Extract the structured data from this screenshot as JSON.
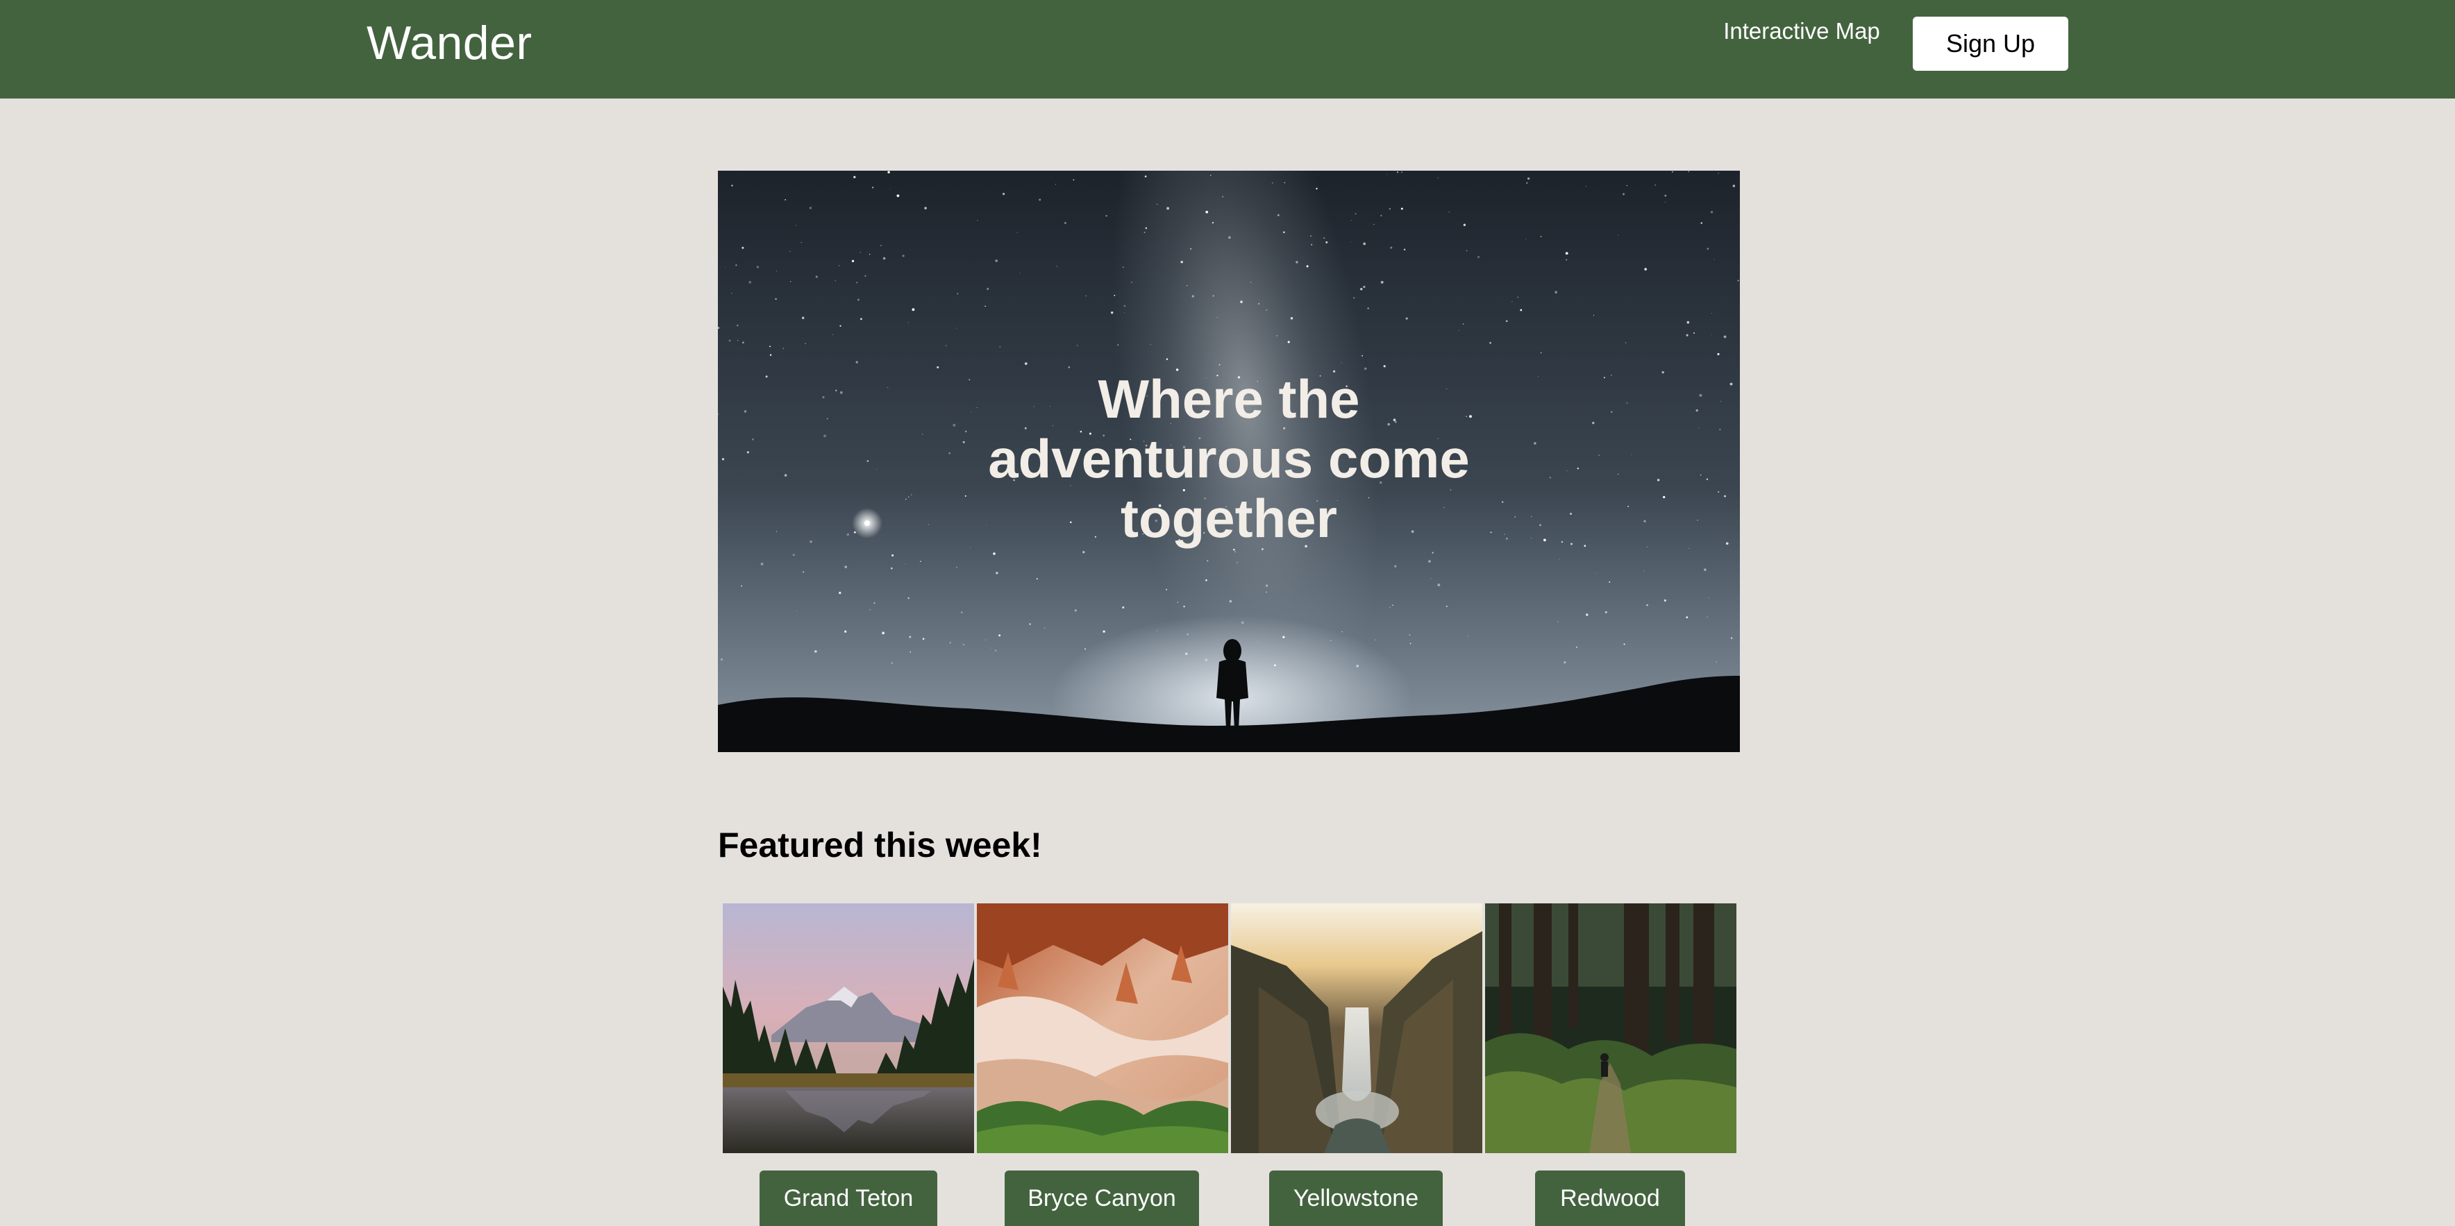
{
  "header": {
    "brand": "Wander",
    "nav_map_label": "Interactive Map",
    "signup_label": "Sign Up"
  },
  "hero": {
    "title": "Where the adventurous come together"
  },
  "featured": {
    "heading": "Featured this week!",
    "parks": [
      {
        "label": "Grand Teton"
      },
      {
        "label": "Bryce Canyon"
      },
      {
        "label": "Yellowstone"
      },
      {
        "label": "Redwood"
      }
    ]
  },
  "colors": {
    "header_bg": "#43633f",
    "page_bg": "#e4e1dd",
    "button_green": "#43633f",
    "hero_text": "#f2ede6"
  }
}
